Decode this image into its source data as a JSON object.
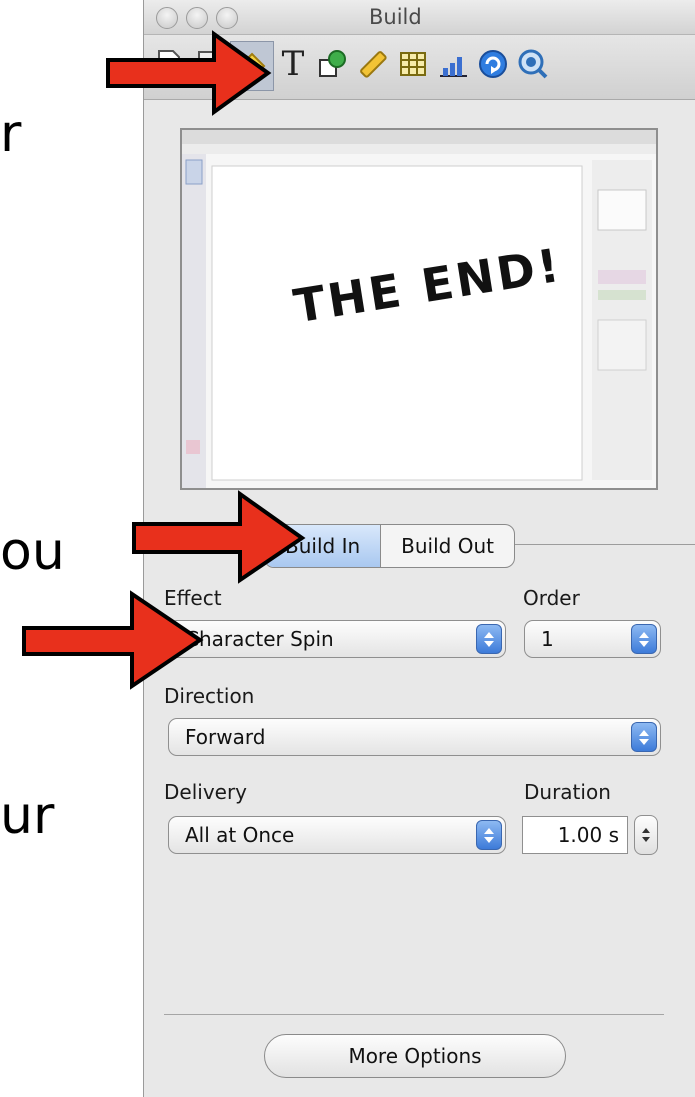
{
  "background_text": {
    "line1": "r",
    "line2": "ou",
    "line3": "ur"
  },
  "window": {
    "title": "Build"
  },
  "toolbar": {
    "tools": [
      {
        "name": "document-icon"
      },
      {
        "name": "page-icon"
      },
      {
        "name": "build-icon",
        "active": true
      },
      {
        "name": "text-icon",
        "glyph": "T"
      },
      {
        "name": "shapes-icon"
      },
      {
        "name": "ruler-icon"
      },
      {
        "name": "table-icon"
      },
      {
        "name": "chart-icon"
      },
      {
        "name": "link-icon"
      },
      {
        "name": "quicktime-icon"
      }
    ]
  },
  "preview": {
    "slide_text": "THE END!"
  },
  "tabs": {
    "build_in": "Build In",
    "build_out": "Build Out",
    "selected": "build_in"
  },
  "effect": {
    "label": "Effect",
    "value": "Character Spin"
  },
  "order": {
    "label": "Order",
    "value": "1"
  },
  "direction": {
    "label": "Direction",
    "value": "Forward"
  },
  "delivery": {
    "label": "Delivery",
    "value": "All at Once"
  },
  "duration": {
    "label": "Duration",
    "value": "1.00 s"
  },
  "more_options": {
    "label": "More Options"
  },
  "colors": {
    "callout_arrow": "#e8301c",
    "selected_tab": "#a9c8f0",
    "popup_button": "#3d7bd9"
  }
}
